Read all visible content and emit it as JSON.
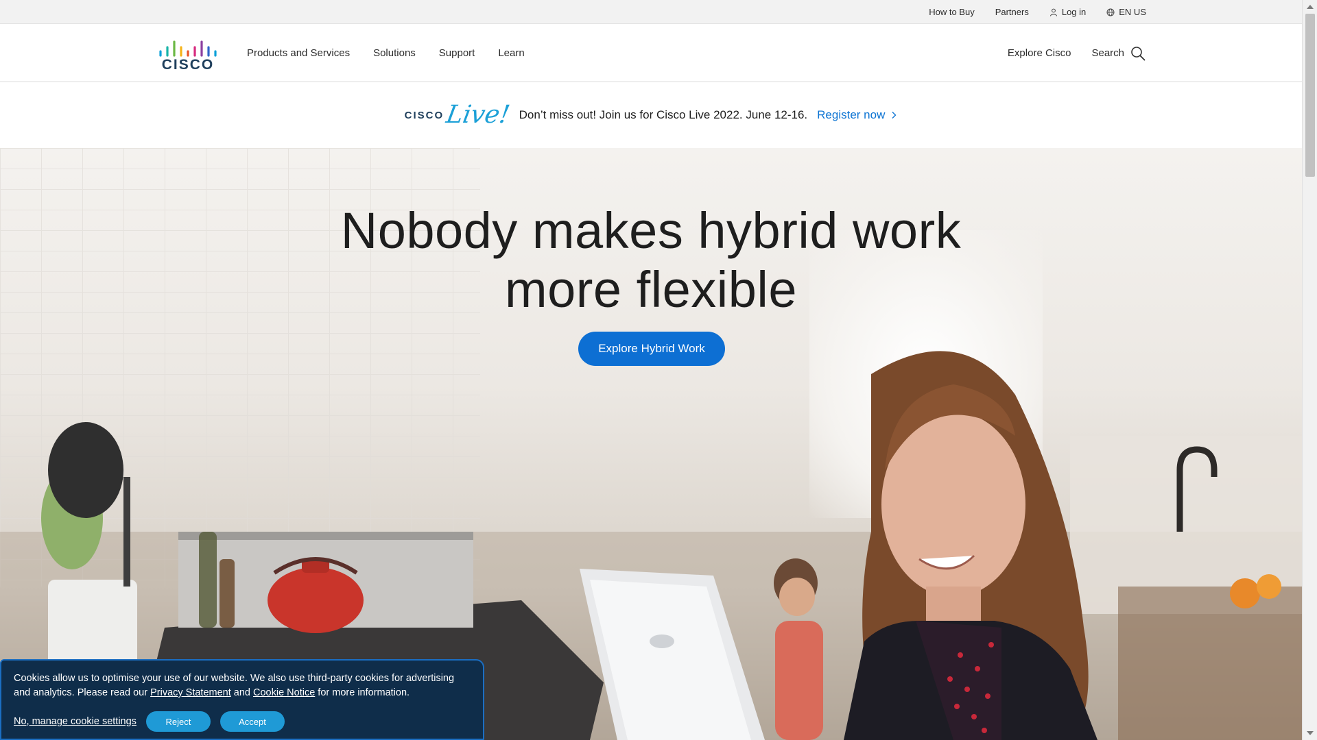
{
  "utility_bar": {
    "links": [
      "How to Buy",
      "Partners"
    ],
    "login_label": "Log in",
    "language_label": "EN US"
  },
  "header": {
    "logo_text": "CISCO",
    "nav": [
      "Products and Services",
      "Solutions",
      "Support",
      "Learn"
    ],
    "explore_label": "Explore Cisco",
    "search_label": "Search"
  },
  "promo": {
    "logo_cisco": "CISCO",
    "logo_live": "Live!",
    "text": "Don’t miss out! Join us for Cisco Live 2022. June 12-16.",
    "register_label": "Register now"
  },
  "hero": {
    "title_line1": "Nobody makes hybrid work",
    "title_line2": "more flexible",
    "cta_label": "Explore Hybrid Work"
  },
  "cookie_banner": {
    "text_before": "Cookies allow us to optimise your use of our website. We also use third-party cookies for advertising and analytics. Please read our ",
    "privacy_link": "Privacy Statement",
    "text_middle": " and ",
    "cookie_link": "Cookie Notice",
    "text_after": " for more information.",
    "manage_label": "No, manage cookie settings",
    "reject_label": "Reject",
    "accept_label": "Accept"
  },
  "colors": {
    "accent_blue": "#0d6fd3",
    "link_blue": "#0d74d3",
    "cookie_bg": "#0f2d4a",
    "cookie_button": "#1f9ad6"
  }
}
